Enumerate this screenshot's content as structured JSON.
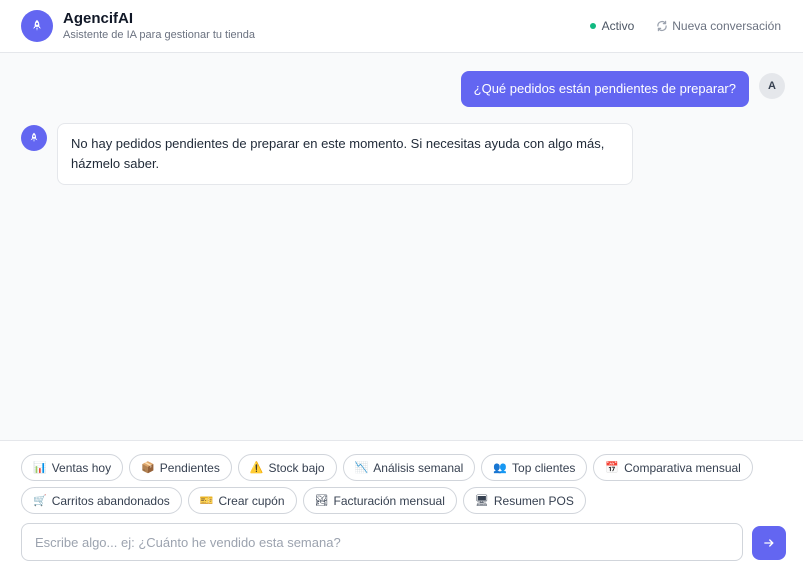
{
  "header": {
    "title": "AgencifAI",
    "subtitle": "Asistente de IA para gestionar tu tienda",
    "status_label": "Activo",
    "new_conversation_label": "Nueva conversación",
    "logo_icon": "rocket-icon"
  },
  "colors": {
    "accent": "#6366f1",
    "status": "#10b981"
  },
  "messages": {
    "user_text": "¿Qué pedidos están pendientes de preparar?",
    "user_avatar": "A",
    "bot_text": "No hay pedidos pendientes de preparar en este momento. Si necesitas ayuda con algo más, házmelo saber."
  },
  "chips": [
    {
      "icon": "📊",
      "label": "Ventas hoy"
    },
    {
      "icon": "📦",
      "label": "Pendientes"
    },
    {
      "icon": "⚠️",
      "label": "Stock bajo"
    },
    {
      "icon": "📉",
      "label": "Análisis semanal"
    },
    {
      "icon": "👥",
      "label": "Top clientes"
    },
    {
      "icon": "📅",
      "label": "Comparativa mensual"
    },
    {
      "icon": "🛒",
      "label": "Carritos abandonados"
    },
    {
      "icon": "🎫",
      "label": "Crear cupón"
    },
    {
      "icon": "🏞",
      "label": "Facturación mensual"
    },
    {
      "icon": "🖥",
      "label": "Resumen POS"
    }
  ],
  "composer": {
    "placeholder": "Escribe algo... ej: ¿Cuánto he vendido esta semana?",
    "value": "",
    "send_icon": "arrow-right-icon"
  }
}
